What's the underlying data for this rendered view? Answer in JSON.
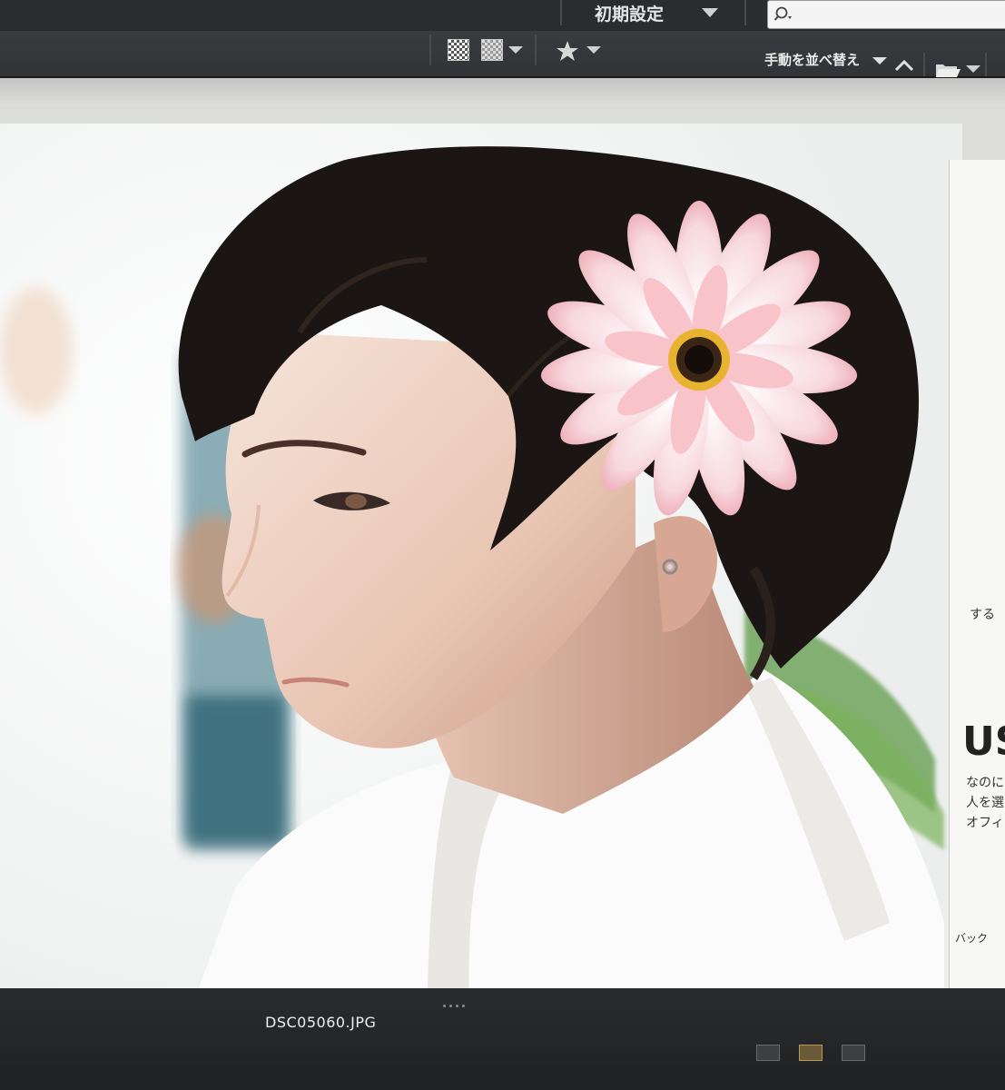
{
  "workspace": {
    "label": "初期設定"
  },
  "search": {
    "placeholder": "",
    "value": ""
  },
  "toolbar": {
    "sort_label": "手動を並べ替え"
  },
  "preview": {
    "filename": "DSC05060.JPG"
  },
  "side_panel": {
    "fragments": [
      "する",
      "US",
      "なのに",
      "人を選に",
      "オフィ",
      "バック"
    ]
  },
  "icons": {
    "search": "search-icon",
    "workspace_menu": "chevron-down-icon",
    "thumbnail_quality": "checkerboard-icon",
    "preview_quality": "checkerboard-icon",
    "rating": "star-icon",
    "sort_ascending": "chevron-up-icon",
    "folder": "folder-icon"
  },
  "colors": {
    "chrome_dark": "#2b2c2e",
    "toolbar": "#363739",
    "text_light": "#e6e6e6",
    "view_active": "#b99a55"
  }
}
